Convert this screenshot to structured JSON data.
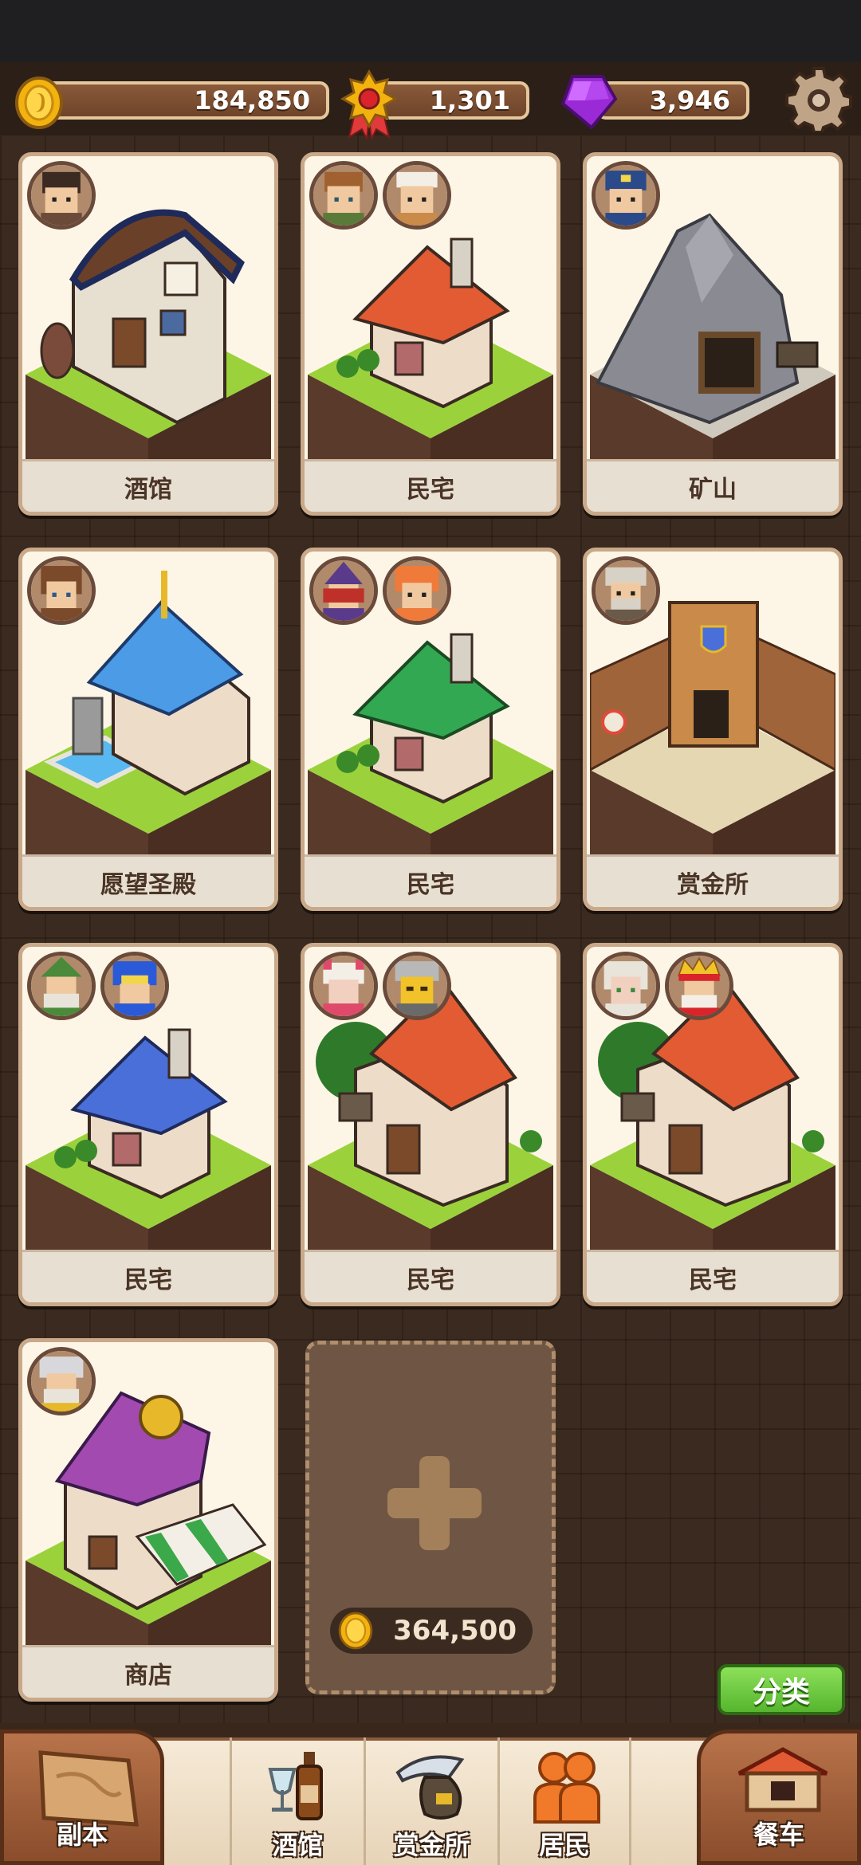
{
  "resources": {
    "gold": "184,850",
    "medals": "1,301",
    "gems": "3,946"
  },
  "colors": {
    "grass": "#9bd23c",
    "dirt": "#5a3a2a",
    "card_bg": "#fdf6e6"
  },
  "buildings": [
    {
      "label": "酒馆",
      "building_type": "tavern",
      "roof": "#5a3a2a",
      "residents": 1
    },
    {
      "label": "民宅",
      "building_type": "house",
      "roof": "#e35b33",
      "residents": 2
    },
    {
      "label": "矿山",
      "building_type": "mine",
      "roof": "#8a8a92",
      "residents": 1
    },
    {
      "label": "愿望圣殿",
      "building_type": "temple",
      "roof": "#4b9be6",
      "residents": 1
    },
    {
      "label": "民宅",
      "building_type": "house",
      "roof": "#33a852",
      "residents": 2
    },
    {
      "label": "赏金所",
      "building_type": "bounty-office",
      "roof": "#c98a4a",
      "residents": 1
    },
    {
      "label": "民宅",
      "building_type": "house",
      "roof": "#4b6fd8",
      "residents": 2
    },
    {
      "label": "民宅",
      "building_type": "big-house",
      "roof": "#e35b33",
      "residents": 2
    },
    {
      "label": "民宅",
      "building_type": "big-house",
      "roof": "#e35b33",
      "residents": 2
    },
    {
      "label": "商店",
      "building_type": "shop",
      "roof": "#a24ab0",
      "residents": 1
    }
  ],
  "add_slot": {
    "cost": "364,500"
  },
  "sort_button": "分类",
  "nav": {
    "dungeon": "副本",
    "tavern": "酒馆",
    "bounty": "赏金所",
    "residents": "居民",
    "food_cart": "餐车"
  }
}
